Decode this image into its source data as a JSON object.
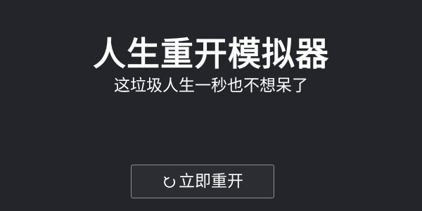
{
  "game": {
    "title": "人生重开模拟器",
    "subtitle": "这垃圾人生一秒也不想呆了",
    "restart_button": {
      "label": "立即重开",
      "icon": "restart-icon"
    }
  },
  "colors": {
    "background": "#23252b",
    "text": "#ffffff",
    "button_border": "#8f9196"
  }
}
